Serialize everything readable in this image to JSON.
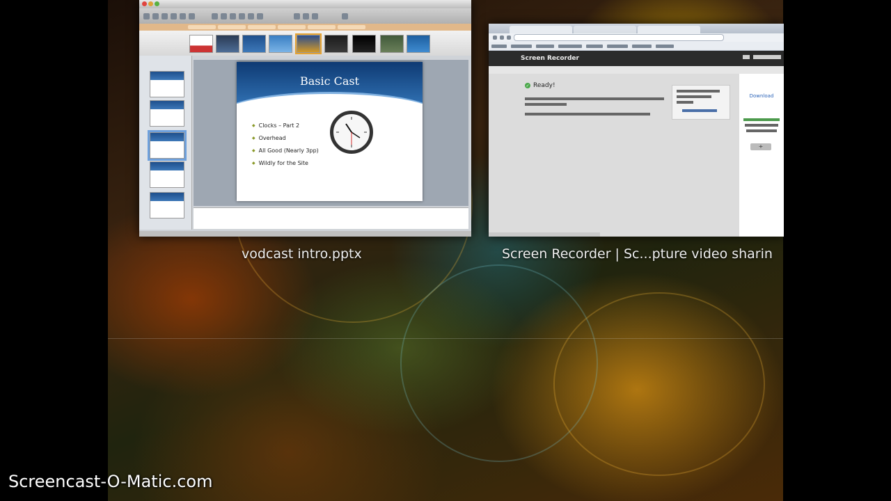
{
  "windows": {
    "powerpoint": {
      "caption": "vodcast intro.pptx",
      "slide": {
        "title": "Basic Cast",
        "bullets": [
          "Clocks – Part 2",
          "Overhead",
          "All Good (Nearly 3pp)",
          "Wildly for the Site"
        ]
      }
    },
    "chrome": {
      "caption": "Screen Recorder | Sc...pture video sharin",
      "page_title": "Screen Recorder",
      "status_text": "Ready!",
      "sidebar_link": "Download",
      "sidebar_button": "+"
    }
  },
  "watermark": "Screencast-O-Matic.com",
  "colors": {
    "slide_header": "#1e4f8c",
    "ready_icon": "#4aa84a",
    "chrome_header": "#2b2b2b"
  }
}
